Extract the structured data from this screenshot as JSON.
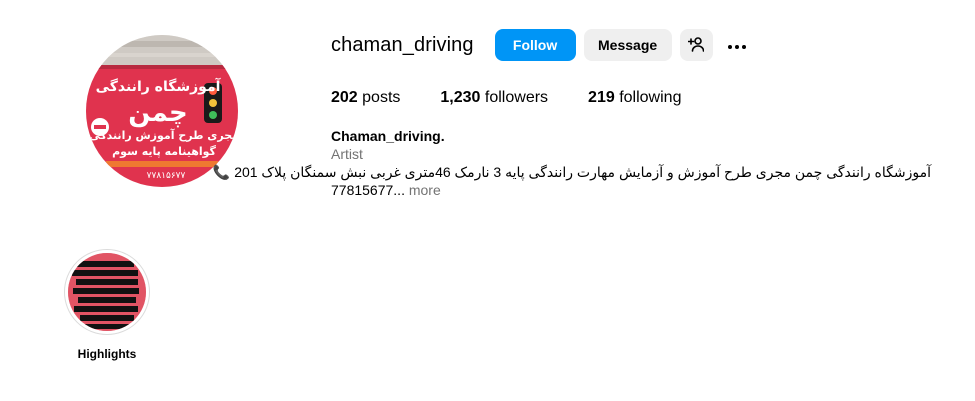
{
  "profile": {
    "username": "chaman_driving",
    "avatar_sign_title": "آموزشگاه رانندگی",
    "avatar_sign_name": "چمن",
    "avatar_sign_line1": "مجری طرح آموزش رانندگی",
    "avatar_sign_line2": "گواهینامه پایه سوم",
    "avatar_sign_phone": "۷۷۸۱۵۶۷۷"
  },
  "actions": {
    "follow_label": "Follow",
    "message_label": "Message"
  },
  "stats": {
    "posts_count": "202",
    "posts_label": "posts",
    "followers_count": "1,230",
    "followers_label": "followers",
    "following_count": "219",
    "following_label": "following"
  },
  "bio": {
    "full_name": "Chaman_driving.",
    "category": "Artist",
    "line1": "آموزشگاه رانندگی چمن مجری طرح آموزش و آزمایش مهارت رانندگی پایه 3 نارمک 46متری غربی نبش سمنگان پلاک 201 📞",
    "line2": "77815677...",
    "more_label": "more"
  },
  "highlights": [
    {
      "label": "Highlights"
    }
  ],
  "icons": {
    "add_user": "add-user-icon",
    "more": "more-options-icon"
  },
  "colors": {
    "follow_bg": "#0095f6",
    "secondary_bg": "#efefef",
    "muted_text": "#737373",
    "sign_red": "#e0334e"
  }
}
